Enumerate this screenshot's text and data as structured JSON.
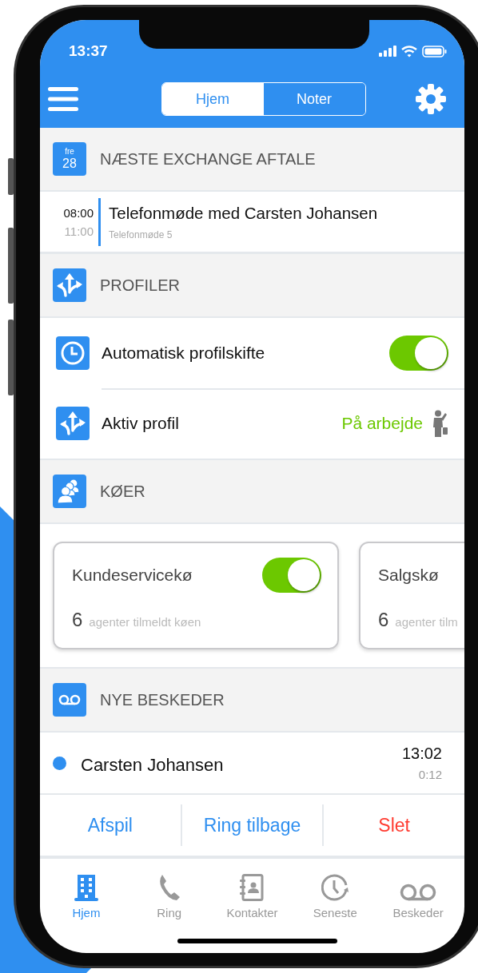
{
  "status_bar": {
    "time": "13:37"
  },
  "header": {
    "tabs": [
      {
        "label": "Hjem",
        "selected": true
      },
      {
        "label": "Noter",
        "selected": false
      }
    ]
  },
  "appointment_section": {
    "title": "NÆSTE EXCHANGE AFTALE",
    "date": {
      "weekday": "fre",
      "day": "28"
    },
    "appointment": {
      "start": "08:00",
      "end": "11:00",
      "title": "Telefonmøde med Carsten Johansen",
      "subtitle": "Telefonmøde 5"
    }
  },
  "profiles_section": {
    "title": "PROFILER",
    "rows": [
      {
        "kind": "toggle",
        "label": "Automatisk profilskifte",
        "on": true
      },
      {
        "kind": "value",
        "label": "Aktiv profil",
        "value": "På arbejde"
      }
    ]
  },
  "queues_section": {
    "title": "KØER",
    "cards": [
      {
        "name": "Kundeservicekø",
        "on": true,
        "count": "6",
        "caption": "agenter tilmeldt køen"
      },
      {
        "name": "Salgskø",
        "count": "6",
        "caption": "agenter tilm"
      }
    ]
  },
  "messages_section": {
    "title": "NYE BESKEDER",
    "items": [
      {
        "name": "Carsten Johansen",
        "time": "13:02",
        "duration": "0:12",
        "unread": true
      }
    ],
    "actions": [
      {
        "label": "Afspil",
        "kind": "primary"
      },
      {
        "label": "Ring tilbage",
        "kind": "primary"
      },
      {
        "label": "Slet",
        "kind": "danger"
      }
    ]
  },
  "tab_bar": [
    {
      "label": "Hjem",
      "selected": true
    },
    {
      "label": "Ring",
      "selected": false
    },
    {
      "label": "Kontakter",
      "selected": false
    },
    {
      "label": "Seneste",
      "selected": false
    },
    {
      "label": "Beskeder",
      "selected": false
    }
  ]
}
